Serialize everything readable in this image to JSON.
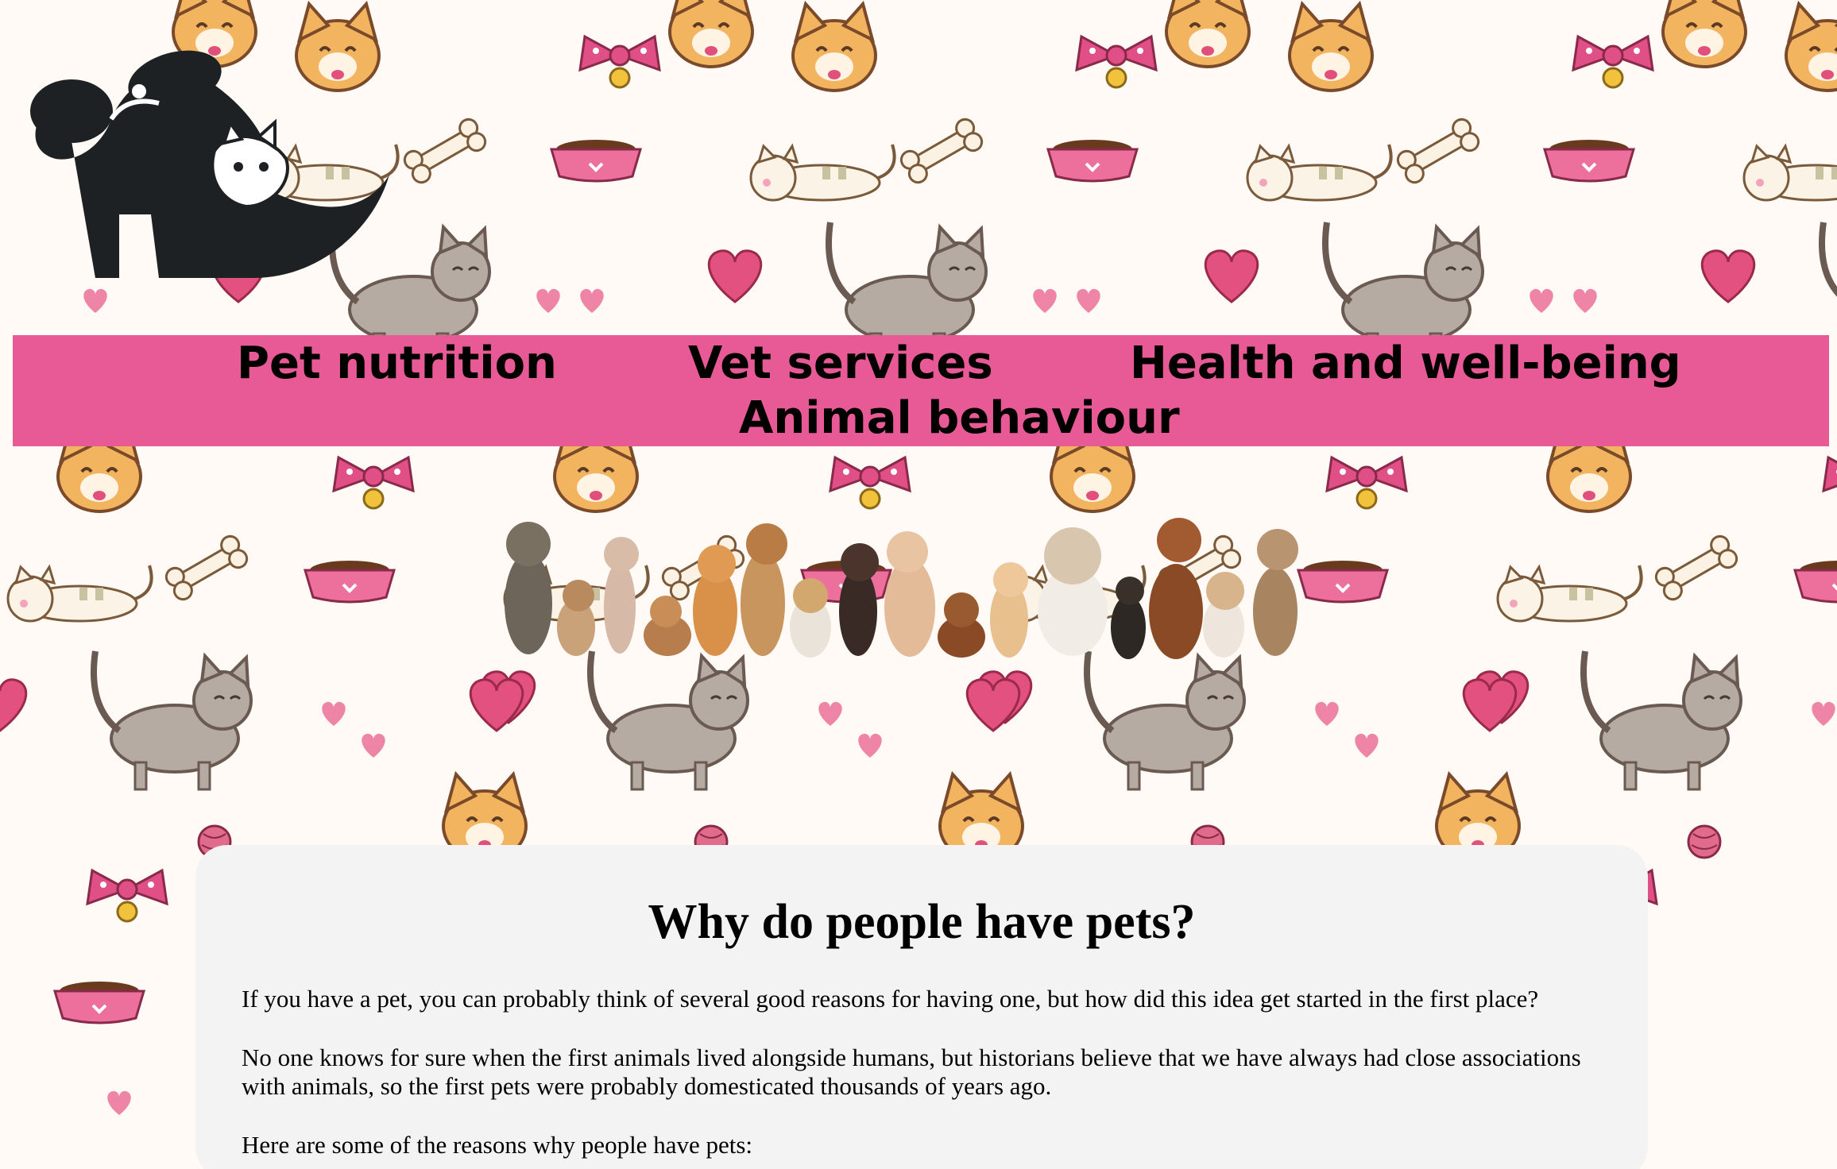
{
  "nav": {
    "items": [
      {
        "label": "Pet nutrition"
      },
      {
        "label": "Vet services"
      },
      {
        "label": "Health and well-being"
      },
      {
        "label": "Animal behaviour"
      }
    ]
  },
  "article": {
    "title": "Why do people have pets?",
    "paragraphs": [
      "If you have a pet, you can probably think of several good reasons for having one, but how did this idea get started in the first place?",
      "No one knows for sure when the first animals lived alongside humans, but historians believe that we have always had close associations with animals, so the first pets were probably domesticated thousands of years ago.",
      "Here are some of the reasons why people have pets:"
    ]
  },
  "colors": {
    "nav_background": "#e85a96",
    "card_background": "#f3f3f3",
    "page_background": "#fffaf6"
  },
  "icons": {
    "logo": "dog-and-cat-logo",
    "background": "cute-pets-pattern",
    "banner": "row-of-cats-and-dogs"
  }
}
